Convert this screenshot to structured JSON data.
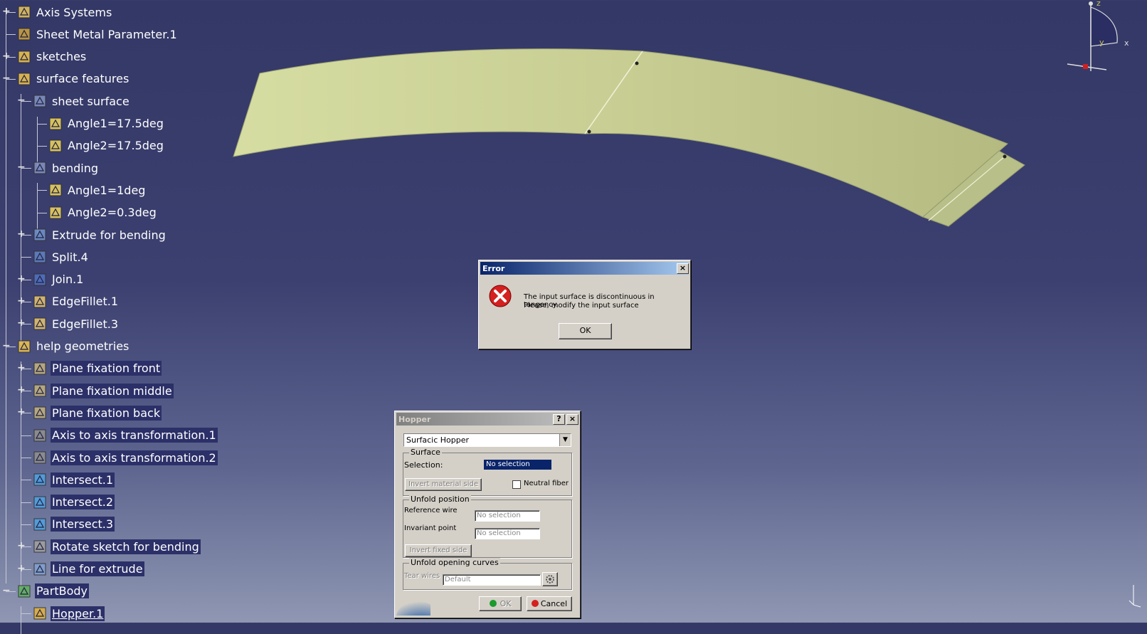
{
  "tree": {
    "items": [
      {
        "label": "Axis Systems",
        "icon": "axis-system-icon"
      },
      {
        "label": "Sheet Metal Parameter.1",
        "icon": "sheet-metal-parameter-icon"
      },
      {
        "label": "sketches",
        "icon": "geometrical-set-icon"
      },
      {
        "label": "surface features",
        "icon": "geometrical-set-icon"
      },
      {
        "label": "sheet surface",
        "icon": "surface-feature-icon"
      },
      {
        "label": "Angle1=17.5deg",
        "icon": "parameter-icon"
      },
      {
        "label": "Angle2=17.5deg",
        "icon": "parameter-icon"
      },
      {
        "label": "bending",
        "icon": "surface-feature-icon"
      },
      {
        "label": "Angle1=1deg",
        "icon": "parameter-icon"
      },
      {
        "label": "Angle2=0.3deg",
        "icon": "parameter-icon"
      },
      {
        "label": "Extrude for bending",
        "icon": "extrude-icon"
      },
      {
        "label": "Split.4",
        "icon": "split-icon"
      },
      {
        "label": "Join.1",
        "icon": "join-icon"
      },
      {
        "label": "EdgeFillet.1",
        "icon": "edge-fillet-icon"
      },
      {
        "label": "EdgeFillet.3",
        "icon": "edge-fillet-icon"
      },
      {
        "label": "help geometries",
        "icon": "geometrical-set-icon"
      },
      {
        "label": "Plane fixation front",
        "icon": "plane-icon"
      },
      {
        "label": "Plane fixation middle",
        "icon": "plane-icon"
      },
      {
        "label": "Plane fixation back",
        "icon": "plane-icon"
      },
      {
        "label": "Axis to axis transformation.1",
        "icon": "axis-transformation-icon"
      },
      {
        "label": "Axis to axis transformation.2",
        "icon": "axis-transformation-icon"
      },
      {
        "label": "Intersect.1",
        "icon": "intersect-icon"
      },
      {
        "label": "Intersect.2",
        "icon": "intersect-icon"
      },
      {
        "label": "Intersect.3",
        "icon": "intersect-icon"
      },
      {
        "label": "Rotate sketch for bending",
        "icon": "rotate-icon"
      },
      {
        "label": "Line for extrude",
        "icon": "line-icon"
      },
      {
        "label": "PartBody",
        "icon": "part-body-icon"
      },
      {
        "label": "Hopper.1",
        "icon": "hopper-icon"
      }
    ]
  },
  "compass": {
    "z": "z",
    "x": "x",
    "y": "y"
  },
  "error_dialog": {
    "title": "Error",
    "message_line1": "The input surface is discontinuous in tangency.",
    "message_line2": "Please, modify the input surface",
    "ok_label": "OK",
    "icon": "error-icon"
  },
  "hopper_dialog": {
    "title": "Hopper",
    "help_label": "?",
    "type_value": "Surfacic Hopper",
    "surface_group": "Surface",
    "selection_label": "Selection:",
    "selection_value": "No selection",
    "invert_material_label": "Invert material side",
    "neutral_fiber_label": "Neutral fiber",
    "neutral_fiber_checked": false,
    "unfold_group": "Unfold position",
    "reference_wire_label": "Reference wire",
    "reference_wire_value": "No selection",
    "invariant_point_label": "Invariant point",
    "invariant_point_value": "No selection",
    "invert_fixed_label": "Invert fixed side",
    "opening_group": "Unfold opening curves",
    "tear_wires_label": "Tear wires",
    "tear_wires_value": "Default",
    "ok_label": "OK",
    "cancel_label": "Cancel"
  },
  "colors": {
    "background": "#3a3e6e",
    "surface_fill": "#c9cf94",
    "highlight": "#2c3068",
    "error_red": "#d42020"
  }
}
